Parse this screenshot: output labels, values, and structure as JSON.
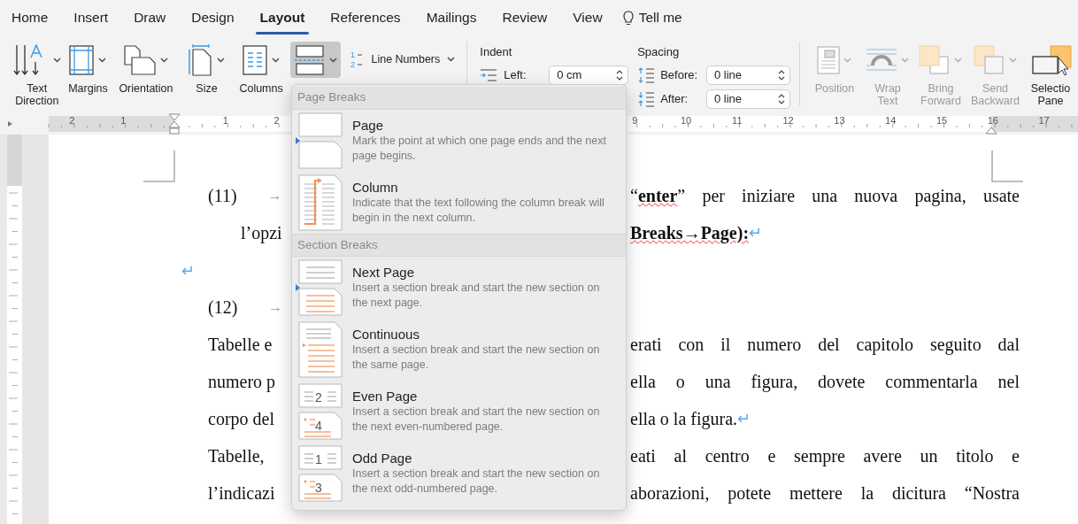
{
  "tabs": [
    {
      "label": "Home",
      "selected": false
    },
    {
      "label": "Insert",
      "selected": false
    },
    {
      "label": "Draw",
      "selected": false
    },
    {
      "label": "Design",
      "selected": false
    },
    {
      "label": "Layout",
      "selected": true
    },
    {
      "label": "References",
      "selected": false
    },
    {
      "label": "Mailings",
      "selected": false
    },
    {
      "label": "Review",
      "selected": false
    },
    {
      "label": "View",
      "selected": false
    }
  ],
  "tell_me": {
    "label": "Tell me"
  },
  "ribbon": {
    "page_setup_buttons": [
      {
        "label": "Text Direction"
      },
      {
        "label": "Margins"
      },
      {
        "label": "Orientation"
      },
      {
        "label": "Size"
      },
      {
        "label": "Columns"
      }
    ],
    "breaks_button": {
      "selected": true
    },
    "line_numbers": {
      "label": "Line Numbers",
      "icon_digits": [
        "1",
        "2"
      ]
    },
    "indent": {
      "title": "Indent",
      "left": {
        "label": "Left:",
        "value": "0 cm"
      }
    },
    "spacing": {
      "title": "Spacing",
      "before": {
        "label": "Before:",
        "value": "0 line"
      },
      "after": {
        "label": "After:",
        "value": "0 line"
      }
    },
    "arrange_buttons": [
      {
        "label": "Position",
        "disabled": true
      },
      {
        "label": "Wrap Text",
        "disabled": true
      },
      {
        "label": "Bring Forward",
        "disabled": true
      },
      {
        "label": "Send Backward",
        "disabled": true
      },
      {
        "label": "Selectio Pane",
        "disabled": false
      }
    ]
  },
  "ruler": {
    "before_indent": [
      "2",
      "1"
    ],
    "after_indent": [
      "1",
      "2"
    ],
    "after_menu": [
      "9",
      "10",
      "11",
      "12",
      "13",
      "14",
      "15",
      "16",
      "17"
    ]
  },
  "document": {
    "lines": [
      {
        "kind": "numbered",
        "number": "(11)",
        "tab_mark": "→",
        "right": "“**enter**” per iniziare una nuova pagina, usate",
        "justified": true
      },
      {
        "kind": "continuation",
        "left": "l’opzi",
        "right": "**Breaks→Page):**",
        "end_mark": "↵",
        "justified": false
      },
      {
        "kind": "empty",
        "end_mark": "↵"
      },
      {
        "kind": "numbered",
        "number": "(12)",
        "tab_mark": "→"
      },
      {
        "kind": "body",
        "left": "Tabelle e",
        "right": "erati con il numero del capitolo seguito dal",
        "justified": true
      },
      {
        "kind": "body",
        "left": "numero p",
        "right": "ella o una figura, dovete commentarla nel",
        "justified": true
      },
      {
        "kind": "body",
        "left": "corpo del",
        "right": "ella o la figura.",
        "end_mark": "↵",
        "justified": false
      },
      {
        "kind": "body",
        "left": "Tabelle,",
        "right": "eati al centro e sempre avere un titolo e",
        "justified": true
      },
      {
        "kind": "body",
        "left": "l’indicazi",
        "right": "aborazioni, potete mettere la dicitura “Nostra",
        "justified": true
      }
    ]
  },
  "breaks_menu": {
    "sections": [
      {
        "title": "Page Breaks",
        "items": [
          {
            "title": "Page",
            "description": "Mark the point at which one page ends and the next page begins."
          },
          {
            "title": "Column",
            "description": "Indicate that the text following the column break will begin in the next column."
          }
        ]
      },
      {
        "title": "Section Breaks",
        "items": [
          {
            "title": "Next Page",
            "description": "Insert a section break and start the new section on the next page."
          },
          {
            "title": "Continuous",
            "description": "Insert a section break and start the new section on the same page."
          },
          {
            "title": "Even Page",
            "description": "Insert a section break and start the new section on the next even-numbered page.",
            "icon_digits": [
              "2",
              "4"
            ]
          },
          {
            "title": "Odd Page",
            "description": "Insert a section break and start the new section on the next odd-numbered page.",
            "icon_digits": [
              "1",
              "3"
            ]
          }
        ]
      }
    ]
  }
}
